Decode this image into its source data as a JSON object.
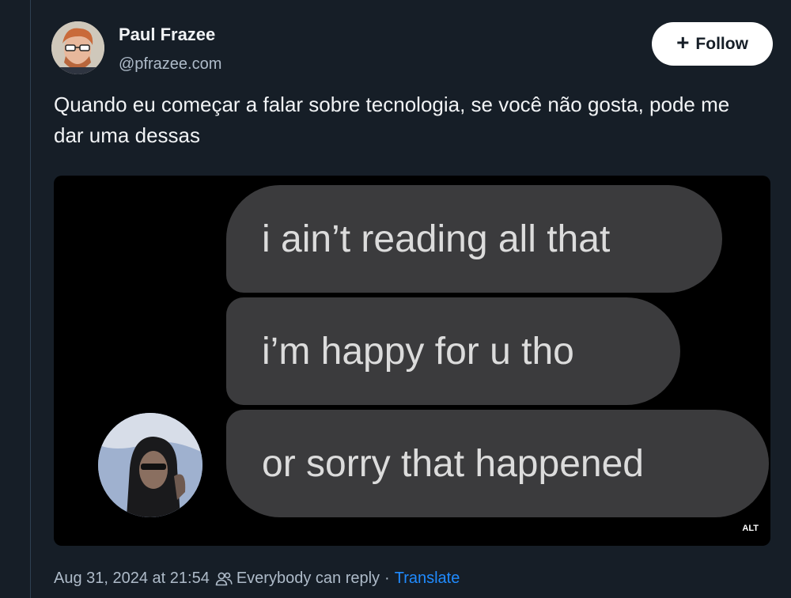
{
  "post": {
    "author_name": "Paul Frazee",
    "author_handle": "@pfrazee.com",
    "follow_label": "Follow",
    "text": "Quando eu começar a falar sobre tecnologia, se você não gosta, pode me dar uma dessas",
    "image": {
      "messages": [
        "i ain’t reading all that",
        "i’m happy for u tho",
        "or sorry that happened"
      ],
      "alt_badge": "ALT"
    },
    "timestamp": "Aug 31, 2024 at 21:54",
    "reply_setting": "Everybody can reply",
    "separator": "·",
    "translate_label": "Translate"
  },
  "icons": {
    "follow": "plus-icon",
    "reply_setting": "people-icon"
  },
  "colors": {
    "background": "#161e27",
    "link": "#208bfe",
    "bubble": "#3b3b3d",
    "secondary_text": "#aebbc9"
  }
}
